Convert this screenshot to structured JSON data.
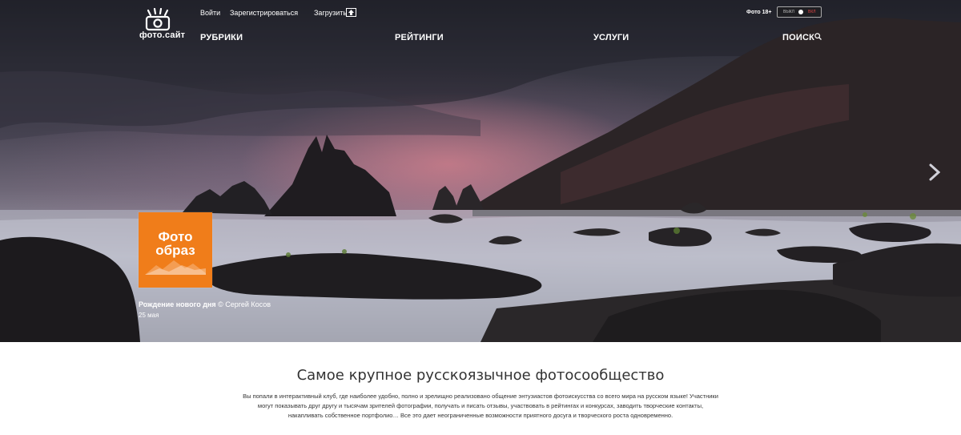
{
  "header": {
    "logo_text": "фото.сайт",
    "login_label": "Войти",
    "register_label": "Зарегистрироваться",
    "upload_label": "Загрузить",
    "adult_filter_label": "Фото 18+",
    "toggle_off_label": "ВЫКЛ",
    "toggle_on_label": "ВКЛ"
  },
  "nav": {
    "items": [
      {
        "label": "РУБРИКИ"
      },
      {
        "label": "РЕЙТИНГИ"
      },
      {
        "label": "УСЛУГИ"
      }
    ],
    "search_label": "ПОИСК"
  },
  "hero": {
    "badge_text_line1": "Фото",
    "badge_text_line2": "образ",
    "caption_title": "Рождение нового дня",
    "caption_author": "© Сергей Косов",
    "caption_date": "25 мая"
  },
  "intro": {
    "title": "Самое крупное русскоязычное фотосообщество",
    "text": "Вы попали в интерактивный клуб, где наиболее удобно, полно и зрелищно реализовано общение энтузиастов фотоискусства со всего мира на русском языке! Участники могут показывать друг другу и тысячам зрителей фотографии, получать и писать отзывы, участвовать в рейтингах и конкурсах, заводить творческие контакты, накапливать собственное портфолио… Все это дает неограниченные возможности приятного досуга и творческого роста одновременно."
  },
  "colors": {
    "badge": "#f07d1a",
    "text_dark": "#333333",
    "toggle_on": "#dd4444"
  }
}
